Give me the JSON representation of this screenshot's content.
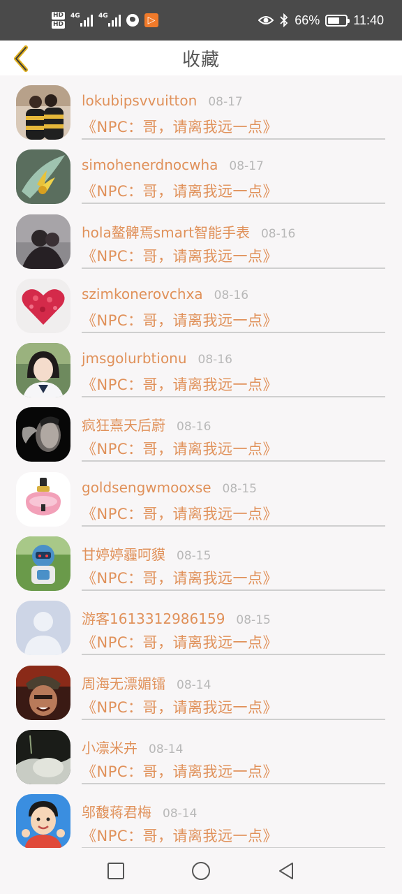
{
  "status_bar": {
    "hd_1": "HD",
    "hd_2": "HD",
    "sig_1": "4G",
    "sig_2": "4G",
    "battery": "66%",
    "battery_level": 0.66,
    "time": "11:40",
    "icons": [
      "eye-icon",
      "bluetooth-icon",
      "battery-icon",
      "globe-icon",
      "app-notification-icon"
    ]
  },
  "header": {
    "title": "收藏",
    "back_icon": "chevron-left-icon",
    "accent": "#e0b020"
  },
  "colors": {
    "accent": "#e0915a",
    "date": "#b8b8b8",
    "divider": "#cfcfcf"
  },
  "items": [
    {
      "name": "lokubipsvvuitton",
      "date": "08-17",
      "subtitle": "《NPC：哥，请离我远一点》"
    },
    {
      "name": "simohenerdnocwha",
      "date": "08-17",
      "subtitle": "《NPC：哥，请离我远一点》"
    },
    {
      "name": "hola鳌髀焉smart智能手表",
      "date": "08-16",
      "subtitle": "《NPC：哥，请离我远一点》"
    },
    {
      "name": "szimkonerovchxa",
      "date": "08-16",
      "subtitle": "《NPC：哥，请离我远一点》"
    },
    {
      "name": "jmsgolurbtionu",
      "date": "08-16",
      "subtitle": "《NPC：哥，请离我远一点》"
    },
    {
      "name": "疯狂熹天后蔚",
      "date": "08-16",
      "subtitle": "《NPC：哥，请离我远一点》"
    },
    {
      "name": "goldsengwmooxse",
      "date": "08-15",
      "subtitle": "《NPC：哥，请离我远一点》"
    },
    {
      "name": "甘婷婷霾呵貘",
      "date": "08-15",
      "subtitle": "《NPC：哥，请离我远一点》"
    },
    {
      "name": "游客1613312986159",
      "date": "08-15",
      "subtitle": "《NPC：哥，请离我远一点》"
    },
    {
      "name": "周海无漂媚镭",
      "date": "08-14",
      "subtitle": "《NPC：哥，请离我远一点》"
    },
    {
      "name": "小凛米卉",
      "date": "08-14",
      "subtitle": "《NPC：哥，请离我远一点》"
    },
    {
      "name": "邬馥蒋君梅",
      "date": "08-14",
      "subtitle": "《NPC：哥，请离我远一点》"
    }
  ],
  "nav_bar": {
    "icons": [
      "recent-apps-icon",
      "home-icon",
      "back-icon"
    ]
  }
}
